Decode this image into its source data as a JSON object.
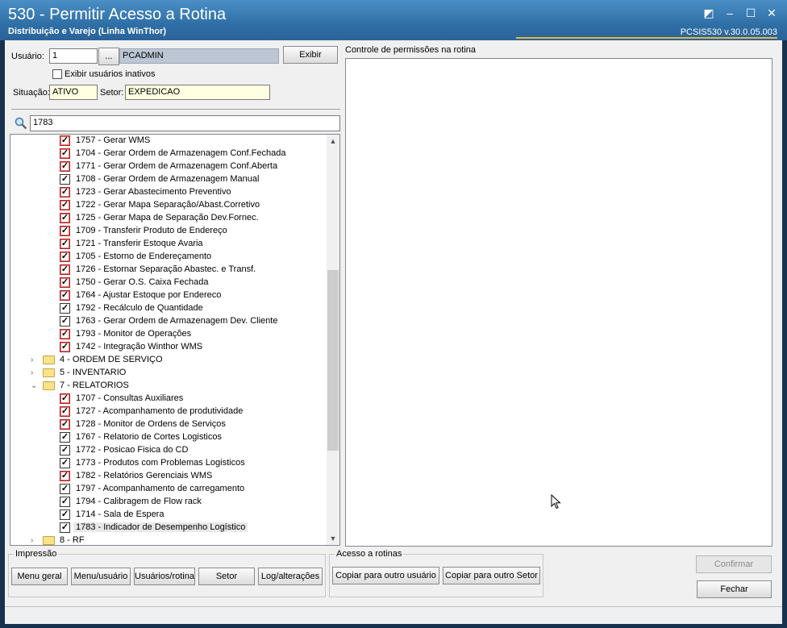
{
  "window": {
    "title": "530 - Permitir Acesso a Rotina",
    "subtitle": "Distribuição e Varejo (Linha WinThor)",
    "version": "PCSIS530  v.30.0.05.003"
  },
  "user_section": {
    "usuario_label": "Usuário:",
    "usuario_value": "1",
    "lookup_button": "...",
    "usuario_name": "PCADMIN",
    "exibir_button": "Exibir",
    "inactive_checkbox_label": "Exibir usuários inativos",
    "situacao_label": "Situação:",
    "situacao_value": "ATIVO",
    "setor_label": "Setor:",
    "setor_value": "EXPEDICAO"
  },
  "search": {
    "value": "1783"
  },
  "permissions_panel": {
    "label": "Controle de permissões na rotina"
  },
  "tree": {
    "rows": [
      {
        "kind": "item",
        "text": "1757 - Gerar WMS",
        "red": true
      },
      {
        "kind": "item",
        "text": "1704 - Gerar Ordem de Armazenagem Conf.Fechada",
        "red": true
      },
      {
        "kind": "item",
        "text": "1771 - Gerar Ordem de Armazenagem Conf.Aberta",
        "red": true
      },
      {
        "kind": "item",
        "text": "1708 - Gerar Ordem de Armazenagem Manual",
        "red": false
      },
      {
        "kind": "item",
        "text": "1723 - Gerar Abastecimento Preventivo",
        "red": true
      },
      {
        "kind": "item",
        "text": "1722 - Gerar Mapa Separação/Abast.Corretivo",
        "red": true
      },
      {
        "kind": "item",
        "text": "1725 - Gerar Mapa de Separação Dev.Fornec.",
        "red": true
      },
      {
        "kind": "item",
        "text": "1709 - Transferir Produto de Endereço",
        "red": true
      },
      {
        "kind": "item",
        "text": "1721 - Transferir Estoque Avaria",
        "red": true
      },
      {
        "kind": "item",
        "text": "1705 - Estorno de Endereçamento",
        "red": true
      },
      {
        "kind": "item",
        "text": "1726 - Estornar Separação Abastec. e Transf.",
        "red": true
      },
      {
        "kind": "item",
        "text": "1750 - Gerar O.S. Caixa Fechada",
        "red": true
      },
      {
        "kind": "item",
        "text": "1764 - Ajustar Estoque por Endereco",
        "red": true
      },
      {
        "kind": "item",
        "text": "1792 - Recálculo de Quantidade",
        "red": false
      },
      {
        "kind": "item",
        "text": "1763 - Gerar Ordem de Armazenagem Dev. Cliente",
        "red": false
      },
      {
        "kind": "item",
        "text": "1793 - Monitor de Operações",
        "red": true
      },
      {
        "kind": "item",
        "text": "1742 - Integração Winthor WMS",
        "red": true
      },
      {
        "kind": "folder",
        "text": "4 - ORDEM DE SERVIÇO",
        "expanded": false
      },
      {
        "kind": "folder",
        "text": "5 - INVENTARIO",
        "expanded": false
      },
      {
        "kind": "folder",
        "text": "7 - RELATORIOS",
        "expanded": true
      },
      {
        "kind": "item",
        "text": "1707 - Consultas Auxiliares",
        "red": true
      },
      {
        "kind": "item",
        "text": "1727 - Acompanhamento de produtividade",
        "red": true
      },
      {
        "kind": "item",
        "text": "1728 - Monitor de Ordens de Serviços",
        "red": true
      },
      {
        "kind": "item",
        "text": "1767 - Relatorio de Cortes Logisticos",
        "red": false
      },
      {
        "kind": "item",
        "text": "1772 - Posicao Fisica do CD",
        "red": false
      },
      {
        "kind": "item",
        "text": "1773 - Produtos com Problemas Logisticos",
        "red": false
      },
      {
        "kind": "item",
        "text": "1782 - Relatórios Gerenciais WMS",
        "red": true
      },
      {
        "kind": "item",
        "text": "1797 - Acompanhamento de carregamento",
        "red": false
      },
      {
        "kind": "item",
        "text": "1794 - Calibragem de Flow rack",
        "red": false
      },
      {
        "kind": "item",
        "text": "1714 - Sala de Espera",
        "red": false
      },
      {
        "kind": "item",
        "text": "1783 - Indicador de Desempenho Logístico",
        "red": false,
        "selected": true
      },
      {
        "kind": "folder",
        "text": "8 - RF",
        "expanded": false
      }
    ]
  },
  "impressao": {
    "title": "Impressão",
    "buttons": [
      "Menu geral",
      "Menu/usuário",
      "Usuários/rotina",
      "Setor",
      "Log/alterações"
    ]
  },
  "acesso": {
    "title": "Acesso a rotinas",
    "copy_user": "Copiar para outro usuário",
    "copy_setor": "Copiar para outro Setor"
  },
  "actions": {
    "confirmar": "Confirmar",
    "fechar": "Fechar"
  },
  "colors": {
    "titlebar": "#2f6fa6",
    "accent_line": "#e6b43c",
    "red_check": "#b01e1e",
    "yellow_field": "#ffffe1"
  }
}
